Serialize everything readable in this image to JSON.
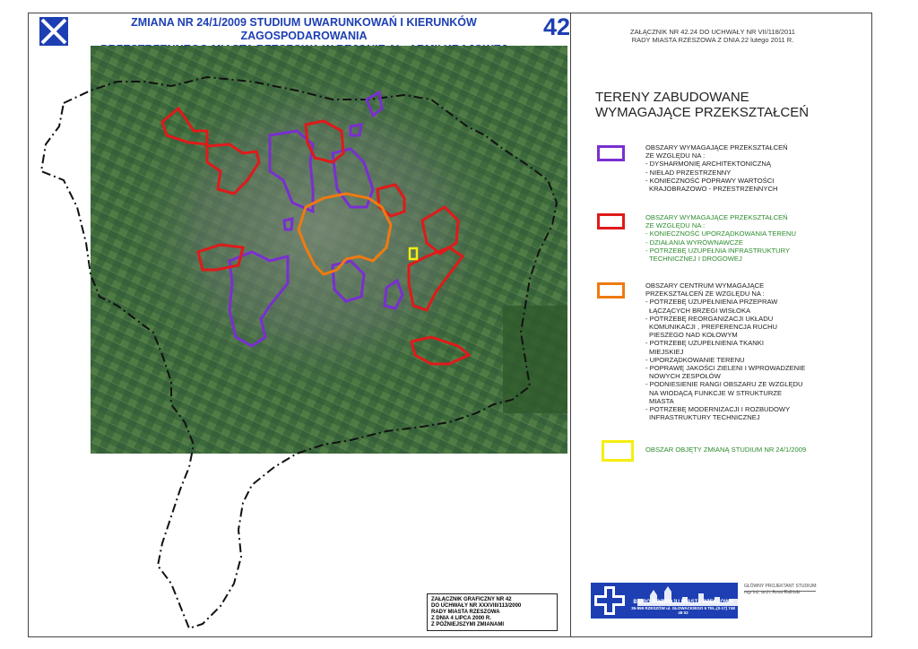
{
  "header": {
    "title_line1": "ZMIANA NR 24/1/2009 STUDIUM UWARUNKOWAŃ I KIERUNKÓW ZAGOSPODAROWANIA",
    "title_line2": "PRZESTRZENNEGO MIASTA RZESZOWA W REJONIE AL. ARMII KRAJOWEJ",
    "number": "42",
    "annex_line1": "ZAŁĄCZNIK NR 42.24 DO UCHWAŁY NR VII/118/2011",
    "annex_line2": "RADY MIASTA RZESZOWA Z DNIA 22 lutego 2011 R."
  },
  "colors": {
    "brand_blue": "#1d3fb3",
    "violet": "#7a2fd0",
    "red": "#e01a1a",
    "orange": "#f07a10",
    "yellow": "#f5ee10",
    "legend_green": "#2d8b2d"
  },
  "legend": {
    "title_line1": "TERENY ZABUDOWANE",
    "title_line2": "WYMAGAJĄCE PRZEKSZTAŁCEŃ",
    "items": [
      {
        "lines": [
          "OBSZARY WYMAGAJĄCE PRZEKSZTAŁCEŃ",
          "ZE WZGLĘDU NA :",
          "- DYSHARMONIĘ ARCHITEKTONICZNĄ",
          "- NIEŁAD PRZESTRZENNY",
          "- KONIECZNOŚĆ POPRAWY WARTOŚCI",
          "  KRAJOBRAZOWO - PRZESTRZENNYCH"
        ]
      },
      {
        "lines": [
          "OBSZARY WYMAGAJĄCE PRZEKSZTAŁCEŃ",
          "ZE WZGLĘDU NA :",
          "- KONIECZNOŚĆ UPORZĄDKOWANIA TERENU",
          "- DZIAŁANIA WYRÓWNAWCZE",
          "- POTRZEBĘ UZUPEŁNIA INFRASTRUKTURY",
          "  TECHNICZNEJ I DROGOWEJ"
        ]
      },
      {
        "lines": [
          "OBSZARY CENTRUM WYMAGAJĄCE",
          "PRZEKSZTAŁCEŃ ZE WZGLĘDU NA :",
          "- POTRZEBĘ UZUPEŁNIENIA PRZEPRAW",
          "  ŁĄCZĄCYCH BRZEGI WISŁOKA",
          "- POTRZEBĘ REORGANIZACJI UKŁADU",
          "  KOMUNIKACJI , PREFERENCJA RUCHU",
          "  PIESZEGO NAD KOŁOWYM",
          "- POTRZEBĘ UZUPEŁNIENIA TKANKI",
          "  MIEJSKIEJ",
          "- UPORZĄDKOWANIE TERENU",
          "- POPRAWĘ JAKOŚCI ZIELENI I WPROWADZENIE",
          "  NOWYCH ZESPOŁÓW",
          "- PODNIESIENIE RANGI OBSZARU ZE WZGLĘDU",
          "  NA WIODĄCĄ FUNKCJE W STRUKTURZE",
          "  MIASTA",
          "- POTRZEBĘ MODERNIZACJI I ROZBUDOWY",
          "  INFRASTRUKTURY TECHNICZNEJ"
        ]
      },
      {
        "lines": [
          "OBSZAR OBJĘTY ZMIANĄ STUDIUM NR 24/1/2009"
        ]
      }
    ]
  },
  "stamp": {
    "lines": [
      "ZAŁĄCZNIK GRAFICZNY NR 42",
      "DO UCHWAŁY NR XXXVIII/113/2000",
      "RADY MIASTA RZESZOWA",
      "Z DNIA 4 LIPCA 2000 R.",
      "Z PÓŹNIEJSZYMI ZMIANAMI"
    ]
  },
  "bureau": {
    "name": "BIURO ROZWOJU MIASTA RZESZOWA",
    "address": "35-959 RZESZÓW ul. GŁOWACKIEGO 6 TEL.(0-17) 748 48 02"
  },
  "designer": {
    "label": "GŁÓWNY PROJEKTANT STUDIUM:",
    "name": "mgr inż. arch. Anna Rafiński"
  }
}
